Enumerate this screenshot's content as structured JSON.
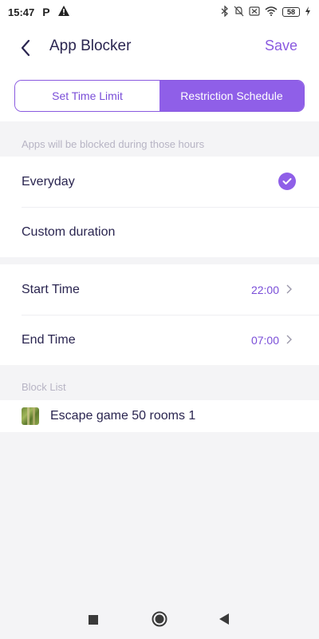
{
  "status_bar": {
    "time": "15:47",
    "notif_p": "P",
    "battery": "58"
  },
  "header": {
    "title": "App Blocker",
    "save_label": "Save"
  },
  "tabs": [
    {
      "label": "Set Time Limit",
      "active": false
    },
    {
      "label": "Restriction Schedule",
      "active": true
    }
  ],
  "schedule": {
    "section_label": "Apps will be blocked during those hours",
    "options": [
      {
        "label": "Everyday",
        "selected": true
      },
      {
        "label": "Custom duration",
        "selected": false
      }
    ]
  },
  "times": {
    "start_label": "Start Time",
    "start_value": "22:00",
    "end_label": "End Time",
    "end_value": "07:00"
  },
  "block_list": {
    "section_label": "Block List",
    "apps": [
      {
        "name": "Escape game 50 rooms 1"
      }
    ]
  },
  "colors": {
    "accent": "#8f5fe8",
    "title_text": "#2a2550",
    "muted_label": "#b7b4c4",
    "background": "#f4f4f6"
  },
  "icons": {
    "back": "chevron-left-icon",
    "check": "check-circle-icon",
    "chevron": "chevron-right-icon"
  }
}
